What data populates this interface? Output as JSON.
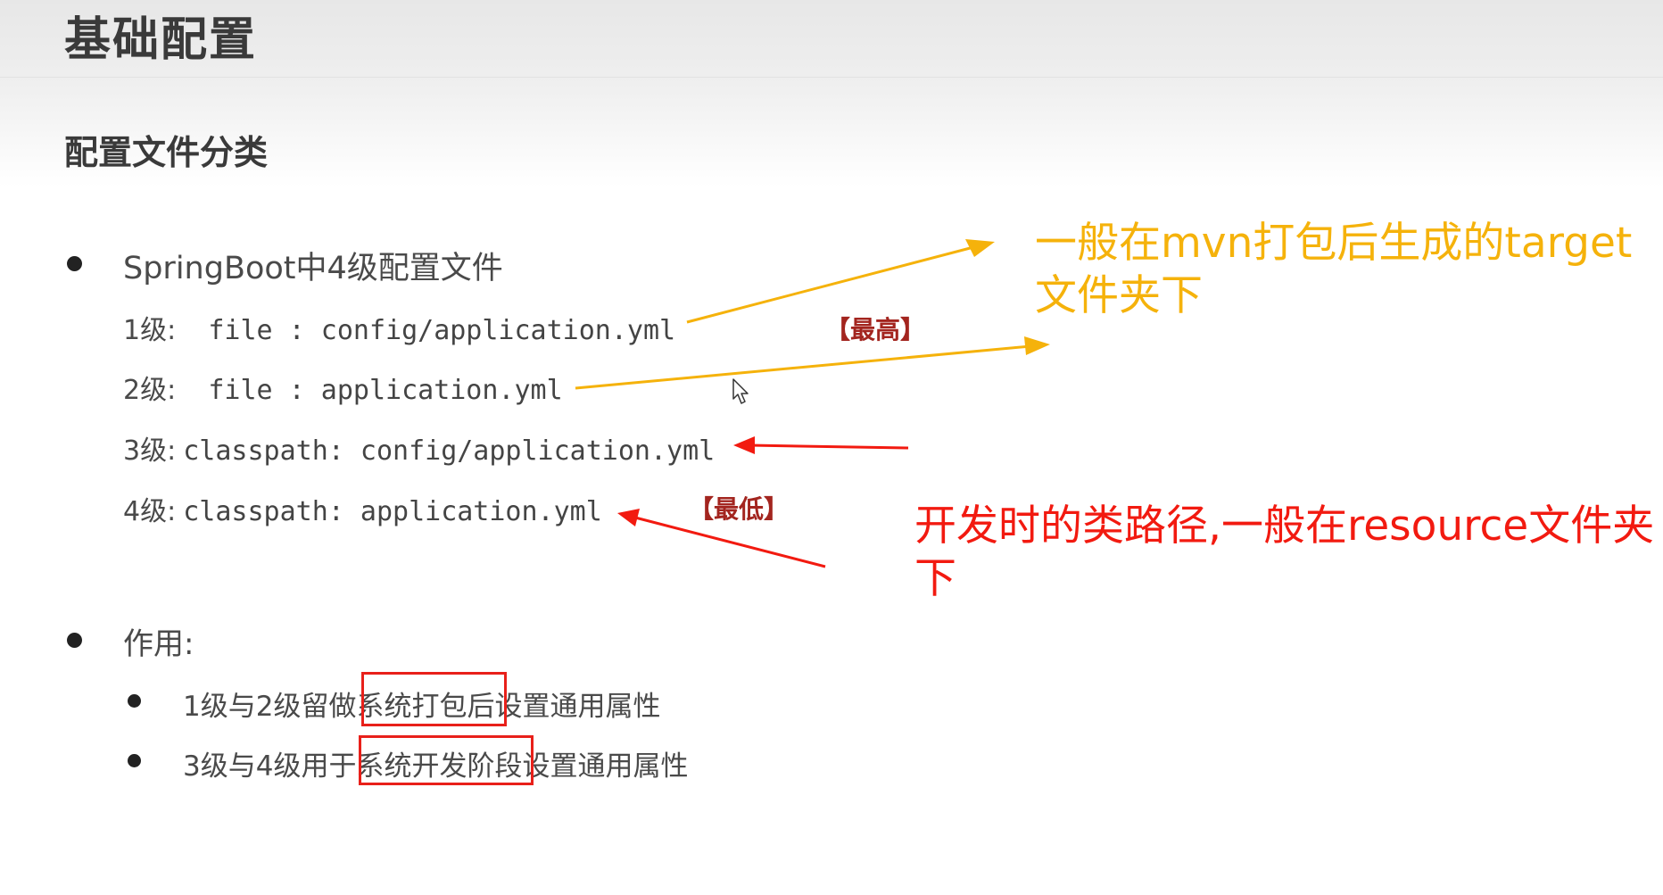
{
  "header": {
    "title": "基础配置",
    "section_title": "配置文件分类"
  },
  "list1": {
    "heading": "SpringBoot中4级配置文件",
    "levels": [
      {
        "prefix": "1级:",
        "value": "  file : config/application.yml",
        "tag": "【最高】"
      },
      {
        "prefix": "2级:",
        "value": "  file : application.yml"
      },
      {
        "prefix": "3级:",
        "value": "classpath: config/application.yml"
      },
      {
        "prefix": "4级:",
        "value": "classpath: application.yml",
        "tag": "【最低】"
      }
    ]
  },
  "list2": {
    "heading": "作用:",
    "items": [
      {
        "before": "1级与2级留做",
        "highlight": "系统打包后",
        "after": "设置通用属性"
      },
      {
        "before": "3级与4级用于",
        "highlight": "系统开发阶段",
        "after": "设置通用属性"
      }
    ]
  },
  "annotations": {
    "orange_line1": "一般在mvn打包后生成的target",
    "orange_line2": "文件夹下",
    "red_line1": "开发时的类路径,一般在resource文件夹",
    "red_line2": "下"
  },
  "colors": {
    "annotation_orange": "#f5b20b",
    "annotation_red": "#f21a10",
    "tag_red": "#a3251f"
  },
  "icons": [
    "bullet-icon",
    "mouse-cursor-icon",
    "arrow-icon"
  ]
}
